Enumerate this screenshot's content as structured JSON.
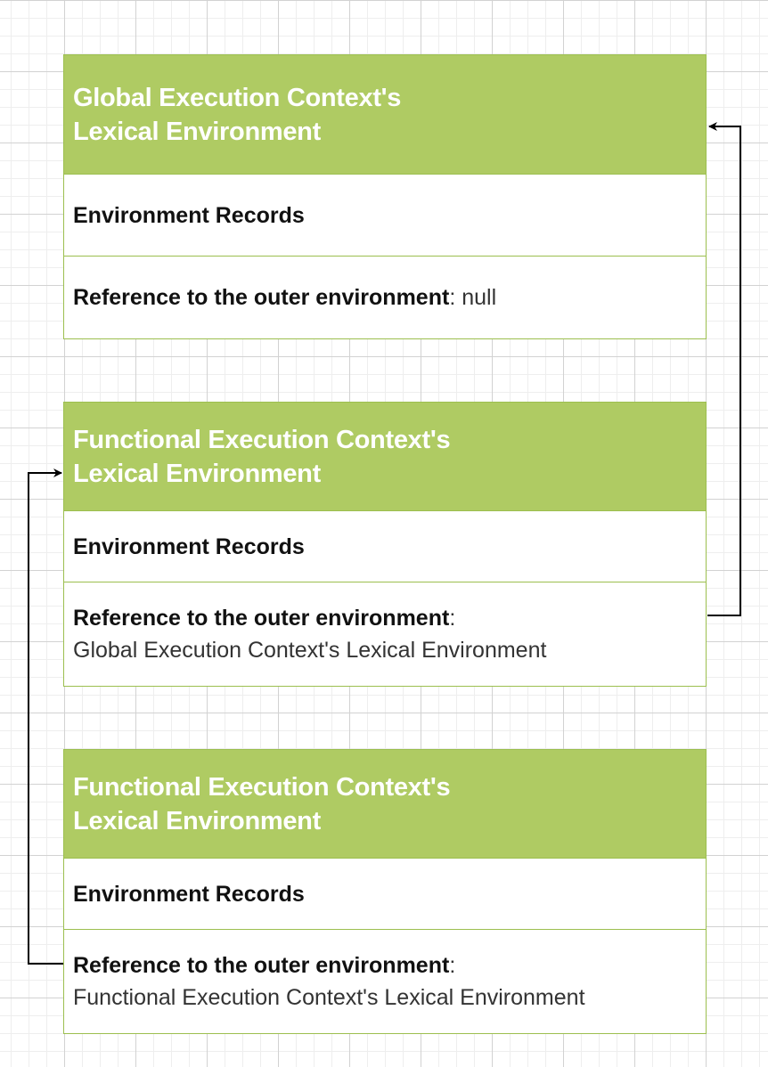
{
  "boxes": [
    {
      "title_line1": "Global Execution Context's",
      "title_line2": "Lexical Environment",
      "records_label": "Environment Records",
      "outer_label": "Reference to the outer environment",
      "outer_sep": ":",
      "outer_value": " null"
    },
    {
      "title_line1": "Functional Execution Context's",
      "title_line2": "Lexical Environment",
      "records_label": "Environment Records",
      "outer_label": "Reference to the outer environment",
      "outer_sep": ":",
      "outer_value": "Global Execution Context's Lexical Environment"
    },
    {
      "title_line1": "Functional Execution Context's",
      "title_line2": "Lexical Environment",
      "records_label": "Environment Records",
      "outer_label": "Reference to the outer environment",
      "outer_sep": ":",
      "outer_value": "Functional Execution Context's Lexical Environment"
    }
  ],
  "colors": {
    "header_fill": "#afcb63",
    "border": "#9cbf4f",
    "connector": "#000000"
  }
}
